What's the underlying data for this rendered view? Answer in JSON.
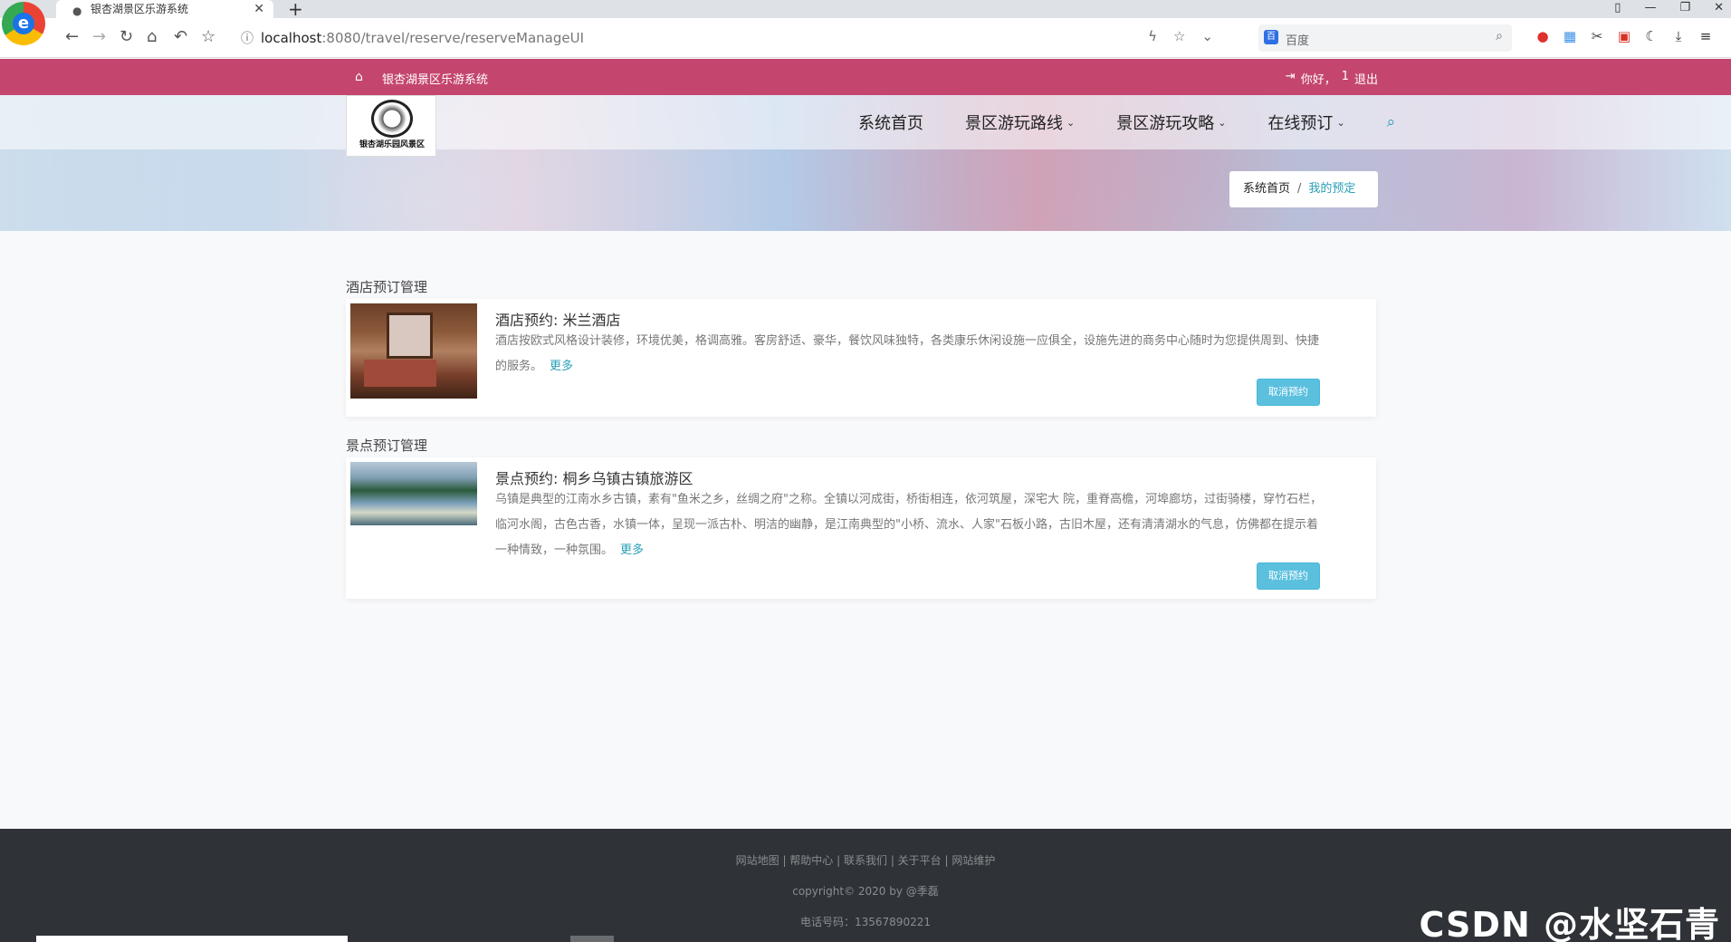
{
  "browser": {
    "tab_title": "银杏湖景区乐游系统",
    "url_host": "localhost",
    "url_rest": ":8080/travel/reserve/reserveManageUI",
    "search_placeholder": "百度"
  },
  "site": {
    "name": "银杏湖景区乐游系统",
    "greeting": "你好，",
    "username": "1",
    "logout": "退出",
    "logo_text": "银杏湖乐园风景区"
  },
  "menu": {
    "home": "系统首页",
    "routes": "景区游玩路线",
    "guides": "景区游玩攻略",
    "booking": "在线预订"
  },
  "breadcrumb": {
    "home": "系统首页",
    "sep": "/",
    "current": "我的预定"
  },
  "hotel_section": {
    "title": "酒店预订管理",
    "card_title": "酒店预约: 米兰酒店",
    "desc": "酒店按欧式风格设计装修，环境优美，格调高雅。客房舒适、豪华，餐饮风味独特，各类康乐休闲设施一应俱全，设施先进的商务中心随时为您提供周到、快捷的服务。",
    "more": "更多",
    "cancel": "取消预约"
  },
  "scenic_section": {
    "title": "景点预订管理",
    "card_title": "景点预约: 桐乡乌镇古镇旅游区",
    "desc": "乌镇是典型的江南水乡古镇，素有\"鱼米之乡，丝绸之府\"之称。全镇以河成街，桥街相连，依河筑屋，深宅大 院，重脊高檐，河埠廊坊，过街骑楼，穿竹石栏，临河水阁，古色古香，水镇一体，呈现一派古朴、明洁的幽静，是江南典型的\"小桥、流水、人家\"石板小路，古旧木屋，还有清清湖水的气息，仿佛都在提示着一种情致，一种氛围。",
    "more": "更多",
    "cancel": "取消预约"
  },
  "footer": {
    "links": [
      "网站地图",
      "帮助中心",
      "联系我们",
      "关于平台",
      "网站维护"
    ],
    "copyright": "copyright© 2020 by @季磊",
    "phone": "电话号码：13567890221"
  },
  "watermark": "CSDN @水坚石青"
}
